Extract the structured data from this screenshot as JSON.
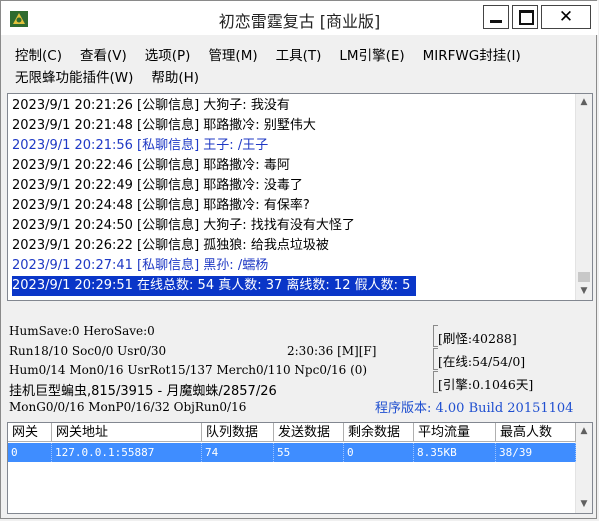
{
  "window": {
    "title": "初恋雷霆复古 [商业版]",
    "close_label": "✕"
  },
  "menu": {
    "row1": [
      "控制(C)",
      "查看(V)",
      "选项(P)",
      "管理(M)",
      "工具(T)",
      "LM引擎(E)",
      "MIRFWG封挂(I)"
    ],
    "row2": [
      "无限蜂功能插件(W)",
      "帮助(H)"
    ]
  },
  "log": [
    {
      "text": "2023/9/1 20:21:26 [公聊信息] 大狗子: 我没有",
      "type": "public"
    },
    {
      "text": "2023/9/1 20:21:48 [公聊信息] 耶路撒冷: 别墅伟大",
      "type": "public"
    },
    {
      "text": "2023/9/1 20:21:56 [私聊信息] 王子: /王子",
      "type": "private"
    },
    {
      "text": "2023/9/1 20:22:46 [公聊信息] 耶路撒冷: 毒阿",
      "type": "public"
    },
    {
      "text": "2023/9/1 20:22:49 [公聊信息] 耶路撒冷: 没毒了",
      "type": "public"
    },
    {
      "text": "2023/9/1 20:24:48 [公聊信息] 耶路撒冷: 有保率?",
      "type": "public"
    },
    {
      "text": "2023/9/1 20:24:50 [公聊信息] 大狗子: 找找有没有大怪了",
      "type": "public"
    },
    {
      "text": "2023/9/1 20:26:22 [公聊信息] 孤独狼: 给我点垃圾被",
      "type": "public"
    },
    {
      "text": "2023/9/1 20:27:41 [私聊信息] 黑孙: /蠕杨",
      "type": "private"
    },
    {
      "text": "2023/9/1 20:29:51 在线总数: 54 真人数: 37 离线数: 12 假人数: 5",
      "type": "selected"
    }
  ],
  "status": {
    "save": "HumSave:0 HeroSave:0",
    "run": "Run18/10 Soc0/0 Usr0/30",
    "time": "2:30:36 [M][F]",
    "hum": "Hum0/14 Mon0/16 UsrRot15/137 Merch0/110 Npc0/16 (0)",
    "mon_info": "挂机巨型蝙虫,815/3915 - 月魔蜘蛛/2857/26",
    "mong": "MonG0/0/16 MonP0/16/32 ObjRun0/16",
    "refresh": "[刷怪:40288]",
    "online": "[在线:54/54/0]",
    "engine": "[引擎:0.1046天]",
    "version": "程序版本: 4.00 Build 20151104"
  },
  "grid": {
    "headers": [
      "网关",
      "网关地址",
      "队列数据",
      "发送数据",
      "剩余数据",
      "平均流量",
      "最高人数"
    ],
    "rows": [
      [
        "0",
        "127.0.0.1:55887",
        "74",
        "55",
        "0",
        "8.35KB",
        "38/39"
      ]
    ]
  },
  "colors": {
    "selection": "#0a36c8",
    "private_msg": "#1f39c4",
    "grid_row": "#3f8dff",
    "version_text": "#1f4fd0"
  },
  "icons": {
    "app": "app-icon",
    "minimize": "minimize-icon",
    "maximize": "maximize-icon",
    "close": "close-icon"
  }
}
